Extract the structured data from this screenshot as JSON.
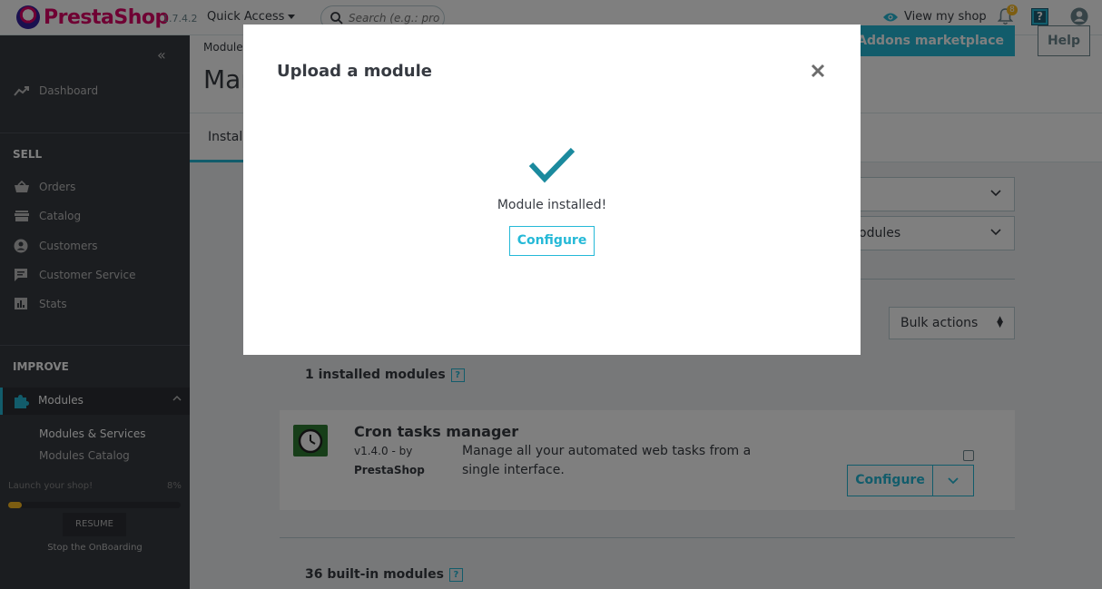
{
  "header": {
    "logo_text": "PrestaShop",
    "version": "1.7.4.2",
    "quick_access": "Quick Access",
    "search_placeholder": "Search (e.g.: product",
    "view_shop": "View my shop",
    "notification_count": "8",
    "help_label": "?"
  },
  "sidebar": {
    "collapse": "«",
    "dashboard": "Dashboard",
    "sell_title": "SELL",
    "sell_items": [
      "Orders",
      "Catalog",
      "Customers",
      "Customer Service",
      "Stats"
    ],
    "improve_title": "IMPROVE",
    "modules": "Modules",
    "sub_items": [
      "Modules & Services",
      "Modules Catalog"
    ],
    "onboarding_text": "Launch your shop!",
    "onboarding_pct": "8%",
    "onboarding_progress": 0.08,
    "resume": "RESUME",
    "stop": "Stop the OnBoarding"
  },
  "toolbar": {
    "breadcrumb": "Modules",
    "title": "Mar",
    "addons_button": "t to Addons marketplace",
    "help_button": "Help"
  },
  "tabs": {
    "installed": "Install"
  },
  "filters": {
    "modules_select": "odules",
    "bulk_actions": "Bulk actions"
  },
  "lists": {
    "installed_count": "1 installed modules",
    "builtin_count": "36 built-in modules",
    "help": "?"
  },
  "module": {
    "name": "Cron tasks manager",
    "version": "v1.4.0 - by",
    "author": "PrestaShop",
    "description": "Manage all your automated web tasks from a single interface.",
    "configure": "Configure"
  },
  "modal": {
    "title": "Upload a module",
    "message": "Module installed!",
    "configure": "Configure"
  },
  "colors": {
    "accent": "#25b9d7",
    "success": "#1b8a9e",
    "brand": "#df0067",
    "sidebar": "#363a41"
  }
}
